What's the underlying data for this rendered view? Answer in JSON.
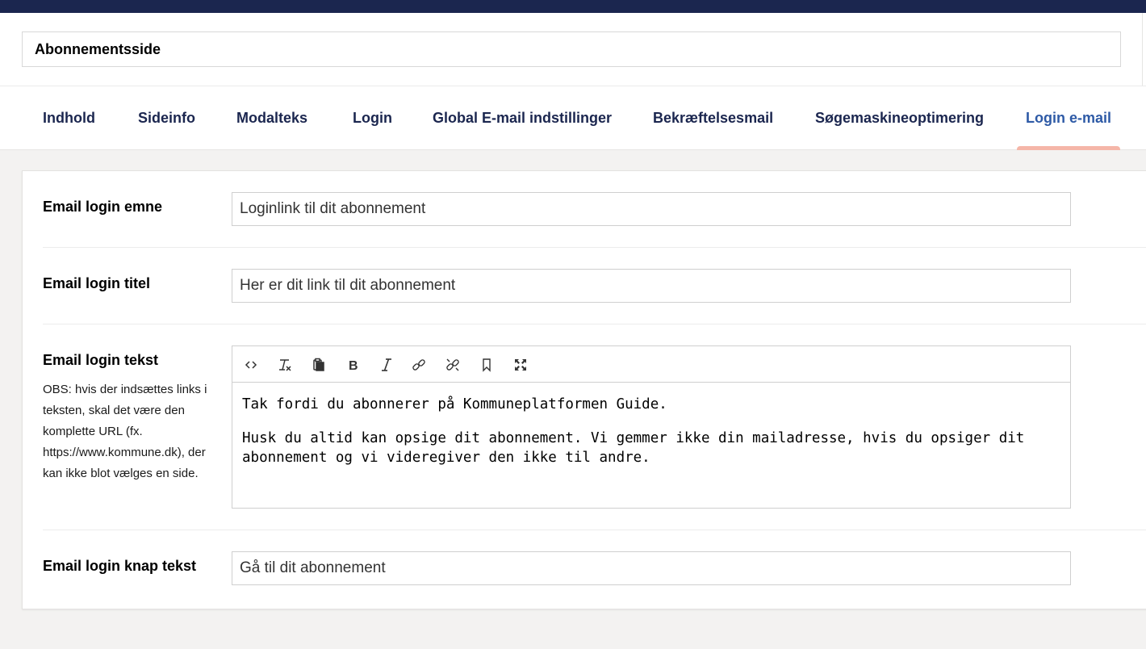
{
  "page": {
    "name_value": "Abonnementsside"
  },
  "tabs": [
    {
      "label": "Indhold"
    },
    {
      "label": "Sideinfo"
    },
    {
      "label": "Modalteks"
    },
    {
      "label": "Login"
    },
    {
      "label": "Global E-mail indstillinger"
    },
    {
      "label": "Bekræftelsesmail"
    },
    {
      "label": "Søgemaskineoptimering"
    },
    {
      "label": "Login e-mail",
      "active": true
    }
  ],
  "form": {
    "subject": {
      "label": "Email login emne",
      "value": "Loginlink til dit abonnement"
    },
    "title": {
      "label": "Email login titel",
      "value": "Her er dit link til dit abonnement"
    },
    "text": {
      "label": "Email login tekst",
      "description": "OBS: hvis der indsættes links i teksten, skal det være den komplette URL (fx. https://www.kommune.dk), der kan ikke blot vælges en side.",
      "paragraphs": [
        "Tak fordi du abonnerer på Kommuneplatformen Guide.",
        "Husk du altid kan opsige dit abonnement. Vi gemmer ikke din mailadresse, hvis du opsiger dit abonnement og vi videregiver den ikke til andre."
      ]
    },
    "button_text": {
      "label": "Email login knap tekst",
      "value": "Gå til dit abonnement"
    }
  },
  "toolbar_icons": [
    "source-code-icon",
    "clear-formatting-icon",
    "paste-icon",
    "bold-icon",
    "italic-icon",
    "link-icon",
    "unlink-icon",
    "bookmark-icon",
    "fullscreen-icon"
  ],
  "colors": {
    "topbar": "#1b264f",
    "tab_text": "#1b264f",
    "active_tab_text": "#2e5aa6",
    "active_tab_indicator": "#f5b6a8",
    "background": "#f3f2f1"
  }
}
